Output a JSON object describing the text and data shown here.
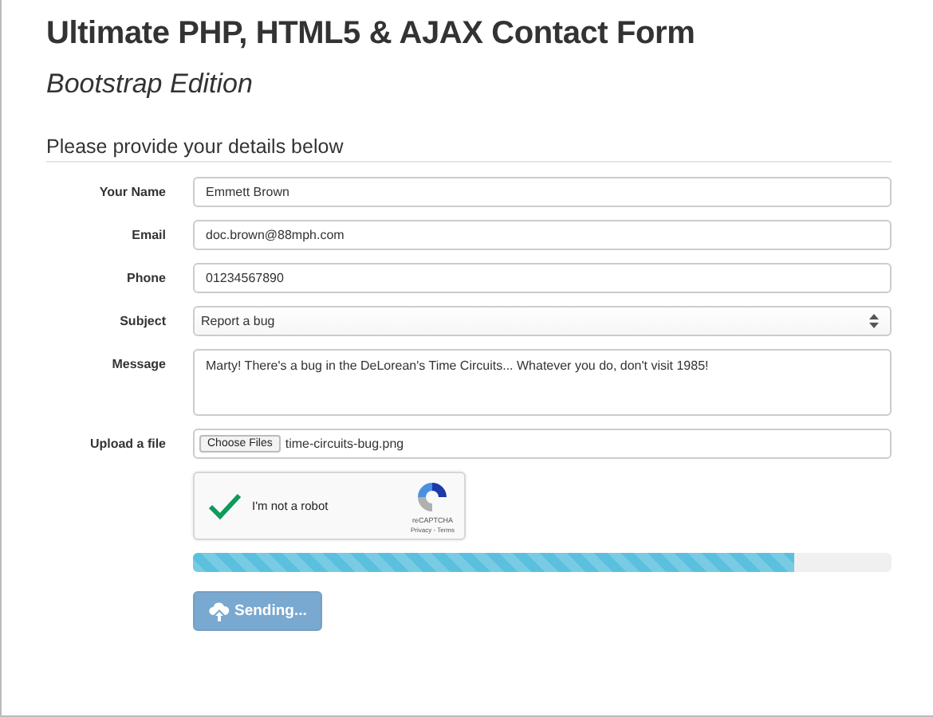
{
  "title": "Ultimate PHP, HTML5 & AJAX Contact Form",
  "subtitle": "Bootstrap Edition",
  "legend": "Please provide your details below",
  "fields": [
    {
      "kind": "text",
      "label": "Your Name",
      "value": "Emmett Brown"
    },
    {
      "kind": "text",
      "label": "Email",
      "value": "doc.brown@88mph.com"
    },
    {
      "kind": "text",
      "label": "Phone",
      "value": "01234567890"
    },
    {
      "kind": "select",
      "label": "Subject",
      "value": "Report a bug"
    },
    {
      "kind": "textarea",
      "label": "Message",
      "value": "Marty! There's a bug in the DeLorean's Time Circuits... Whatever you do, don't visit 1985!"
    },
    {
      "kind": "file",
      "label": "Upload a file",
      "button": "Choose Files",
      "value": "time-circuits-bug.png"
    }
  ],
  "captcha": {
    "label": "I'm not a robot",
    "checked": true,
    "brand": "reCAPTCHA",
    "links": "Privacy - Terms"
  },
  "progress": {
    "level": 0.86
  },
  "submit": {
    "label": "Sending...",
    "disabled": true
  }
}
